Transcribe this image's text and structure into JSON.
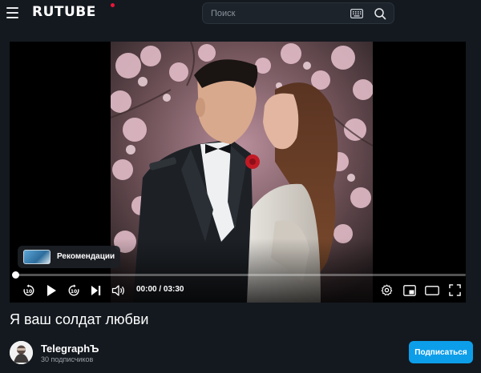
{
  "header": {
    "logo_text": "RUTUBE",
    "menu_icon": "hamburger-menu-icon",
    "search": {
      "placeholder": "Поиск",
      "value": "",
      "keyboard_icon": "keyboard-icon",
      "search_icon": "search-icon"
    }
  },
  "player": {
    "recommendations_label": "Рекомендации",
    "current_time": "00:00",
    "separator": " / ",
    "duration": "03:30",
    "progress": 0,
    "controls": {
      "left": [
        "rewind-10-icon",
        "play-icon",
        "forward-10-icon",
        "next-icon",
        "volume-icon"
      ],
      "right": [
        "settings-gear-icon",
        "picture-in-picture-icon",
        "theater-mode-icon",
        "fullscreen-icon"
      ]
    }
  },
  "video": {
    "title": "Я ваш солдат любви"
  },
  "channel": {
    "name": "TelegraphЪ",
    "subscribers": "30 подписчиков",
    "subscribe_label": "Подписаться"
  },
  "colors": {
    "background": "#14191f",
    "accent_blue": "#0d9eea",
    "logo_dot_red": "#ed143b"
  }
}
